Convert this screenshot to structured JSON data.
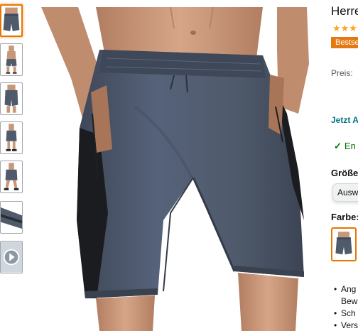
{
  "product": {
    "title": "Herre",
    "stars": "★★★",
    "badge": "Bestse",
    "price_label": "Preis:",
    "price_line1": "",
    "price_line2": "",
    "jetzt_link": "Jetzt A",
    "stock": "En",
    "size_label": "Größe",
    "size_value": "Ausw",
    "color_label": "Farbe:"
  },
  "bullets": [
    {
      "text": "Ang"
    },
    {
      "text": "Bew"
    },
    {
      "text": "Sch"
    },
    {
      "text": "Vers"
    }
  ],
  "gallery": {
    "selected_index": 0,
    "thumbnail_count": 7,
    "thumbnails": [
      "front",
      "front-full",
      "side",
      "side-full",
      "pose",
      "fabric-detail",
      "video"
    ]
  },
  "colors": {
    "shorts": "#4f5a6b",
    "shorts_dark": "#3e4757",
    "panel": "#1b1c1f",
    "skin": "#c79779",
    "accent_orange": "#e77600",
    "badge": "#e47911",
    "stars": "#ffa41c",
    "link": "#007185",
    "in_stock": "#007600"
  }
}
